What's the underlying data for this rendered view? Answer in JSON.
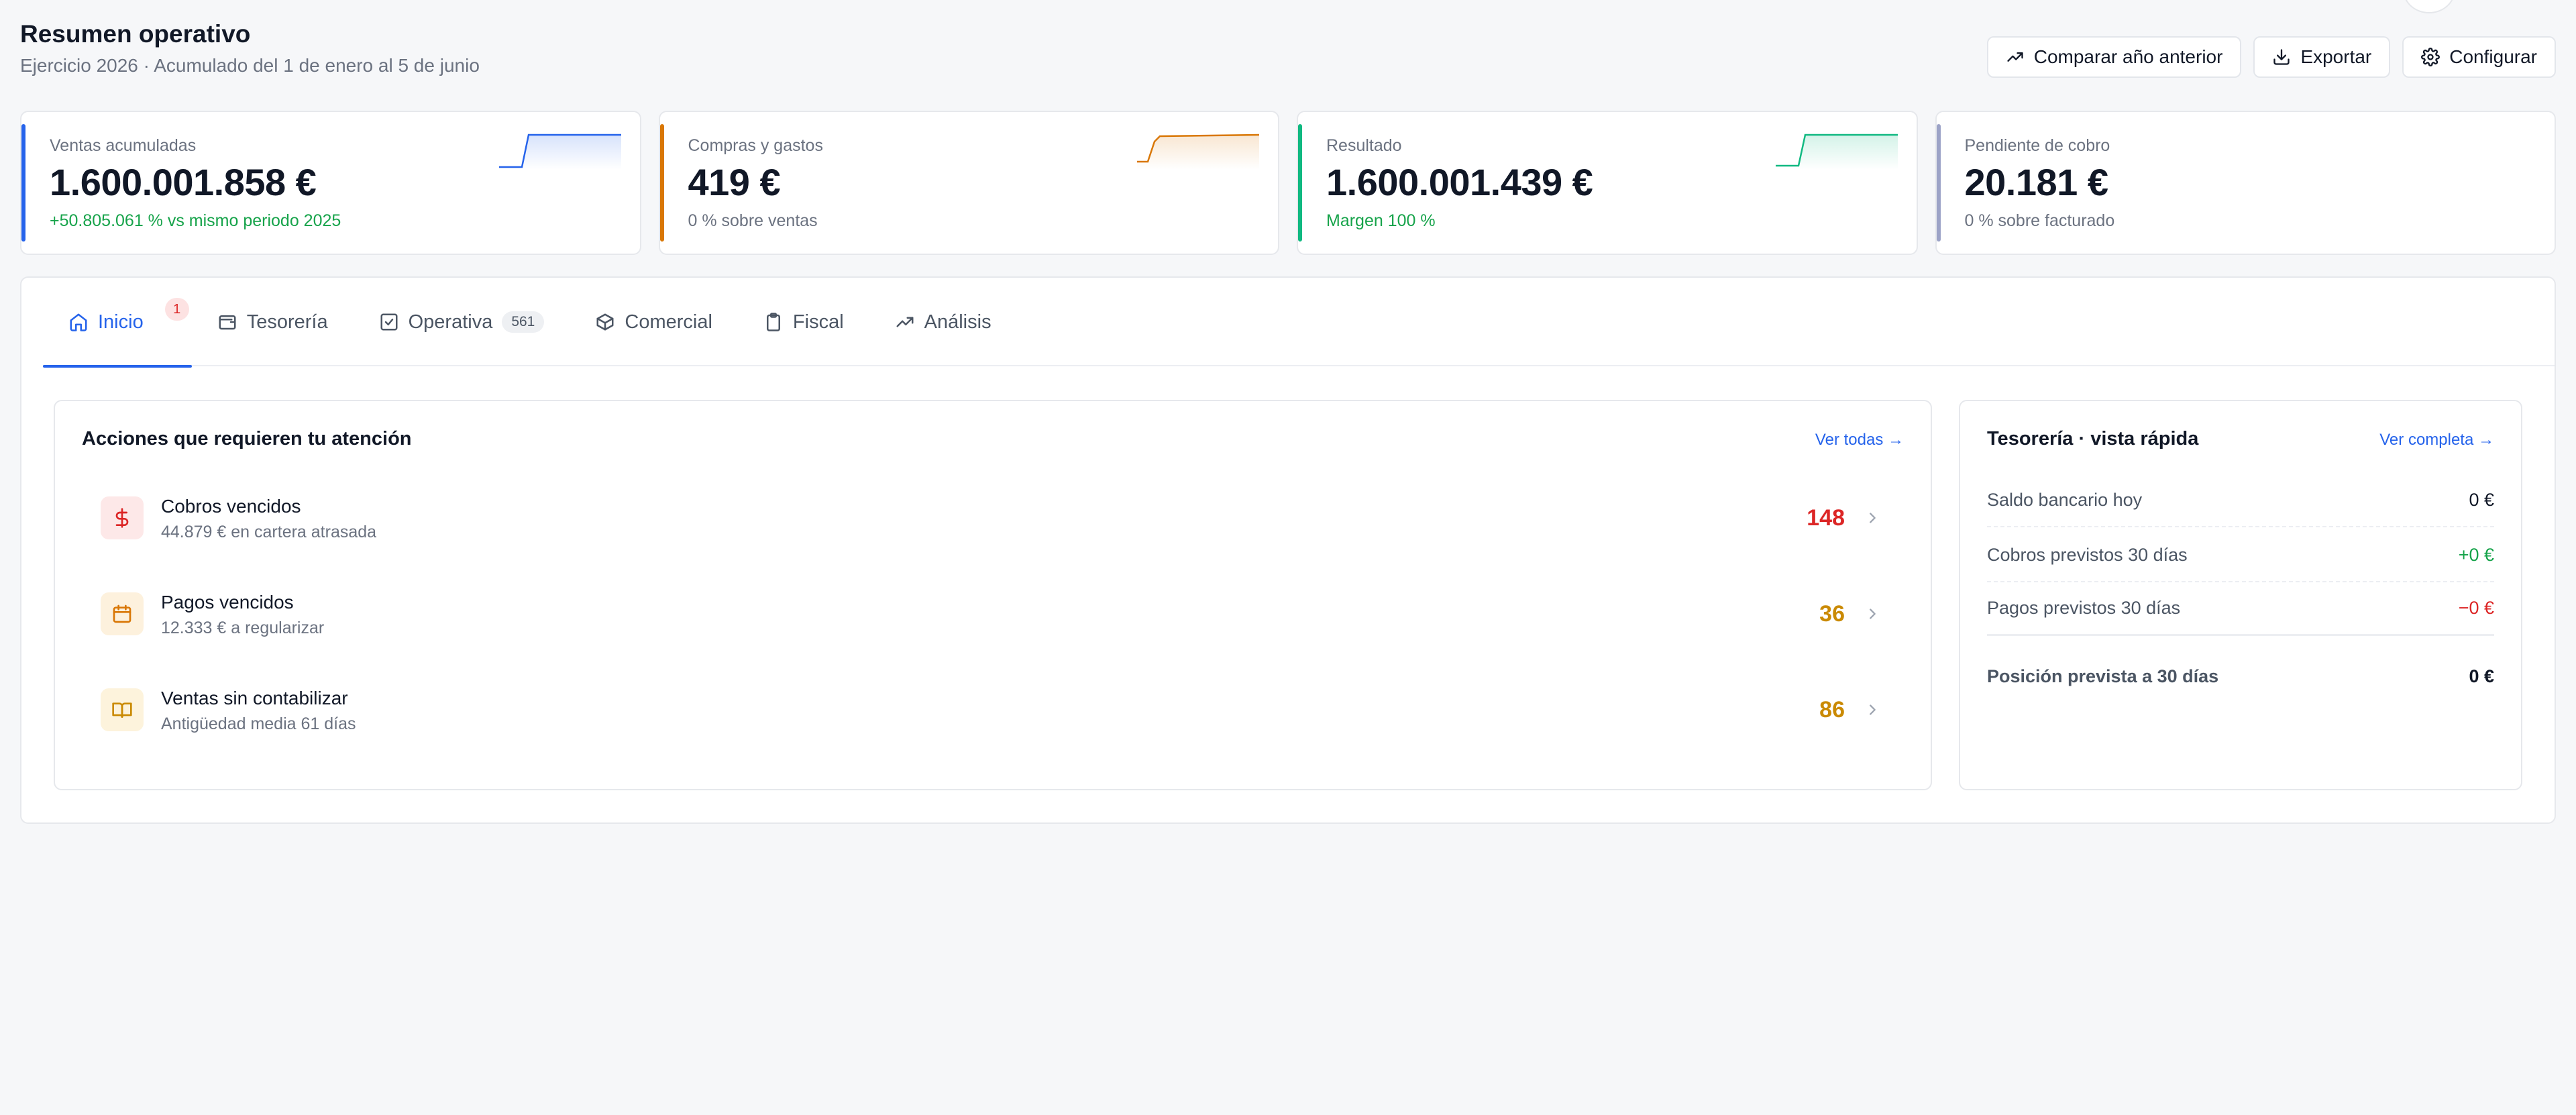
{
  "header": {
    "title": "Resumen operativo",
    "subtitle": "Ejercicio 2026 · Acumulado del 1 de enero al 5 de junio"
  },
  "toolbar": {
    "compare_label": "Comparar año anterior",
    "export_label": "Exportar",
    "configure_label": "Configurar"
  },
  "kpis": [
    {
      "label": "Ventas acumuladas",
      "value": "1.600.001.858 €",
      "note": "+50.805.061 % vs mismo periodo 2025",
      "color": "#2563eb"
    },
    {
      "label": "Compras y gastos",
      "value": "419 €",
      "note": "0 % sobre ventas",
      "color": "#d97706"
    },
    {
      "label": "Resultado",
      "value": "1.600.001.439 €",
      "note": "Margen 100 %",
      "color": "#10b981"
    },
    {
      "label": "Pendiente de cobro",
      "value": "20.181 €",
      "note": "0 % sobre facturado",
      "color": "#9ca3c7"
    }
  ],
  "tabs": [
    {
      "label": "Inicio",
      "badge": "1"
    },
    {
      "label": "Tesorería"
    },
    {
      "label": "Operativa",
      "badge": "561"
    },
    {
      "label": "Comercial"
    },
    {
      "label": "Fiscal"
    },
    {
      "label": "Análisis"
    }
  ],
  "actions": {
    "title": "Acciones que requieren tu atención",
    "link": "Ver todas →",
    "items": [
      {
        "title": "Cobros vencidos",
        "desc": "44.879 € en cartera atrasada",
        "count": "148",
        "color": "#dc2626",
        "icon": "dollar-icon"
      },
      {
        "title": "Pagos vencidos",
        "desc": "12.333 € a regularizar",
        "count": "36",
        "color": "#ca8a04",
        "icon": "calendar-icon"
      },
      {
        "title": "Ventas sin contabilizar",
        "desc": "Antigüedad media 61 días",
        "count": "86",
        "color": "#ca8a04",
        "icon": "book-icon"
      }
    ]
  },
  "treasury": {
    "title": "Tesorería · vista rápida",
    "link": "Ver completa →",
    "rows": [
      {
        "label": "Saldo bancario hoy",
        "value": "0 €",
        "color": "#111827"
      },
      {
        "label": "Cobros previstos 30 días",
        "value": "+0 €",
        "color": "#16a34a"
      },
      {
        "label": "Pagos previstos 30 días",
        "value": "−0 €",
        "color": "#dc2626"
      }
    ],
    "total_label": "Posición prevista a 30 días",
    "total_value": "0 €"
  }
}
